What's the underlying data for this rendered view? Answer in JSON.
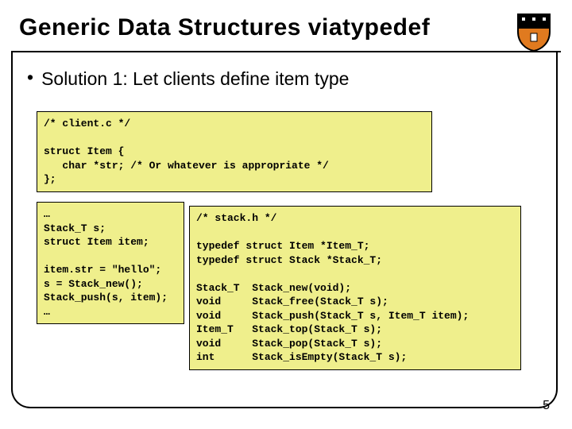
{
  "title": "Generic Data Structures viatypedef",
  "bullet1": "Solution 1: Let clients define item type",
  "code": {
    "client_struct": "/* client.c */\n\nstruct Item {\n   char *str; /* Or whatever is appropriate */\n};",
    "client_usage": "…\nStack_T s;\nstruct Item item;\n\nitem.str = \"hello\";\ns = Stack_new();\nStack_push(s, item);\n…",
    "stack_header": "/* stack.h */\n\ntypedef struct Item *Item_T;\ntypedef struct Stack *Stack_T;\n\nStack_T  Stack_new(void);\nvoid     Stack_free(Stack_T s);\nvoid     Stack_push(Stack_T s, Item_T item);\nItem_T   Stack_top(Stack_T s);\nvoid     Stack_pop(Stack_T s);\nint      Stack_isEmpty(Stack_T s);"
  },
  "page_number": "5"
}
